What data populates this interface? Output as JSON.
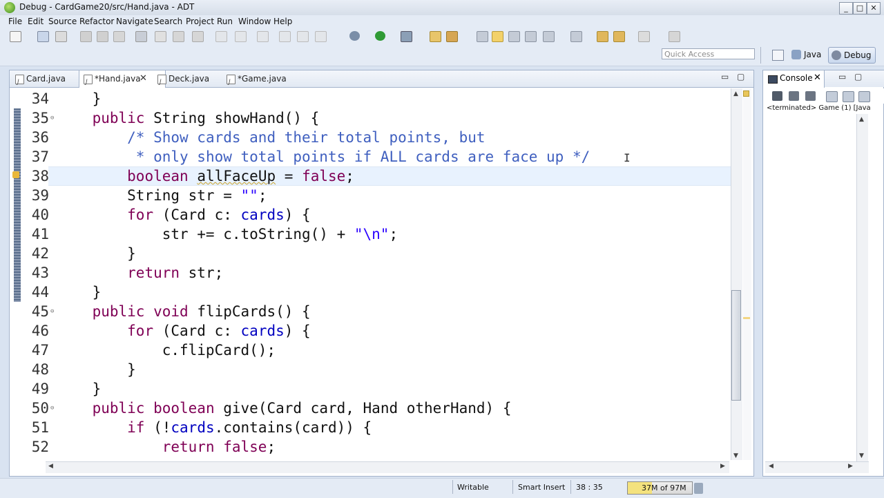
{
  "window": {
    "title": "Debug - CardGame20/src/Hand.java - ADT",
    "min": "0",
    "max": "1",
    "close": "r"
  },
  "menu": [
    "File",
    "Edit",
    "Source",
    "Refactor",
    "Navigate",
    "Search",
    "Project",
    "Run",
    "Window",
    "Help"
  ],
  "quick_access": {
    "placeholder": "Quick Access"
  },
  "perspectives": [
    {
      "label": "Java"
    },
    {
      "label": "Debug",
      "active": true
    }
  ],
  "editor": {
    "tabs": [
      {
        "label": "Card.java"
      },
      {
        "label": "*Hand.java",
        "active": true,
        "close": "✕"
      },
      {
        "label": "Deck.java"
      },
      {
        "label": "*Game.java"
      }
    ],
    "minimize": "▭",
    "maximize": "▢",
    "cursor_glyph": "I",
    "lines": [
      {
        "num": "34",
        "fold": false,
        "tokens": [
          {
            "t": "    }"
          }
        ]
      },
      {
        "num": "35",
        "fold": true,
        "tokens": [
          {
            "t": "    "
          },
          {
            "t": "public",
            "c": "kw"
          },
          {
            "t": " String showHand() {"
          }
        ]
      },
      {
        "num": "36",
        "fold": false,
        "tokens": [
          {
            "t": "        "
          },
          {
            "t": "/* Show cards and their total points, but",
            "c": "cm"
          }
        ]
      },
      {
        "num": "37",
        "fold": false,
        "tokens": [
          {
            "t": "         "
          },
          {
            "t": "* only show total points if ALL cards are face up */",
            "c": "cm"
          }
        ]
      },
      {
        "num": "38",
        "fold": false,
        "current": true,
        "tokens": [
          {
            "t": "        "
          },
          {
            "t": "boolean",
            "c": "kw"
          },
          {
            "t": " "
          },
          {
            "t": "allFaceUp",
            "c": "squig"
          },
          {
            "t": " = "
          },
          {
            "t": "false",
            "c": "kw"
          },
          {
            "t": ";"
          }
        ]
      },
      {
        "num": "39",
        "fold": false,
        "tokens": [
          {
            "t": "        String str = "
          },
          {
            "t": "\"\"",
            "c": "str"
          },
          {
            "t": ";"
          }
        ]
      },
      {
        "num": "40",
        "fold": false,
        "tokens": [
          {
            "t": "        "
          },
          {
            "t": "for",
            "c": "kw"
          },
          {
            "t": " (Card c: "
          },
          {
            "t": "cards",
            "c": "fld"
          },
          {
            "t": ") {"
          }
        ]
      },
      {
        "num": "41",
        "fold": false,
        "tokens": [
          {
            "t": "            str += c.toString() + "
          },
          {
            "t": "\"\\n\"",
            "c": "str"
          },
          {
            "t": ";"
          }
        ]
      },
      {
        "num": "42",
        "fold": false,
        "tokens": [
          {
            "t": "        }"
          }
        ]
      },
      {
        "num": "43",
        "fold": false,
        "tokens": [
          {
            "t": "        "
          },
          {
            "t": "return",
            "c": "kw"
          },
          {
            "t": " str;"
          }
        ]
      },
      {
        "num": "44",
        "fold": false,
        "tokens": [
          {
            "t": "    }"
          }
        ]
      },
      {
        "num": "45",
        "fold": true,
        "tokens": [
          {
            "t": "    "
          },
          {
            "t": "public",
            "c": "kw"
          },
          {
            "t": " "
          },
          {
            "t": "void",
            "c": "kw"
          },
          {
            "t": " flipCards() {"
          }
        ]
      },
      {
        "num": "46",
        "fold": false,
        "tokens": [
          {
            "t": "        "
          },
          {
            "t": "for",
            "c": "kw"
          },
          {
            "t": " (Card c: "
          },
          {
            "t": "cards",
            "c": "fld"
          },
          {
            "t": ") {"
          }
        ]
      },
      {
        "num": "47",
        "fold": false,
        "tokens": [
          {
            "t": "            c.flipCard();"
          }
        ]
      },
      {
        "num": "48",
        "fold": false,
        "tokens": [
          {
            "t": "        }"
          }
        ]
      },
      {
        "num": "49",
        "fold": false,
        "tokens": [
          {
            "t": "    }"
          }
        ]
      },
      {
        "num": "50",
        "fold": true,
        "tokens": [
          {
            "t": "    "
          },
          {
            "t": "public",
            "c": "kw"
          },
          {
            "t": " "
          },
          {
            "t": "boolean",
            "c": "kw"
          },
          {
            "t": " give(Card card, Hand otherHand) {"
          }
        ]
      },
      {
        "num": "51",
        "fold": false,
        "tokens": [
          {
            "t": "        "
          },
          {
            "t": "if",
            "c": "kw"
          },
          {
            "t": " (!"
          },
          {
            "t": "cards",
            "c": "fld"
          },
          {
            "t": ".contains(card)) {"
          }
        ]
      },
      {
        "num": "52",
        "fold": false,
        "tokens": [
          {
            "t": "            "
          },
          {
            "t": "return",
            "c": "kw"
          },
          {
            "t": " "
          },
          {
            "t": "false",
            "c": "kw"
          },
          {
            "t": ";"
          }
        ]
      }
    ]
  },
  "console": {
    "tab_label": "Console",
    "close": "✕",
    "status": "<terminated> Game (1) [Java"
  },
  "statusbar": {
    "writable": "Writable",
    "insert_mode": "Smart Insert",
    "position": "38 : 35",
    "heap": "37M of 97M",
    "heap_used_fraction": 0.38
  },
  "colors": {
    "keyword": "#7f0055",
    "comment": "#3f5fbf",
    "string": "#2a00ff",
    "field": "#0000c0",
    "current_line": "#e8f2fe"
  }
}
